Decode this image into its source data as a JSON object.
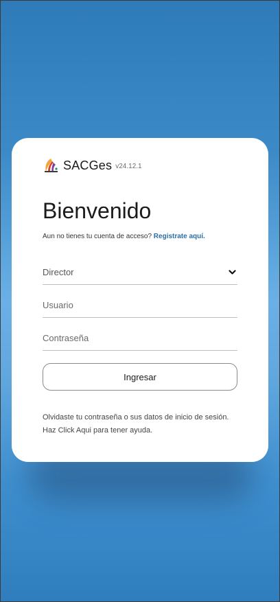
{
  "app": {
    "name": "SACGes",
    "version": "v24.12.1"
  },
  "login": {
    "title": "Bienvenido",
    "signup_prompt": "Aun no tienes tu cuenta de acceso?",
    "signup_link": "Registrate aquí.",
    "role_select": {
      "selected": "Director"
    },
    "username": {
      "placeholder": "Usuario"
    },
    "password": {
      "placeholder": "Contraseña"
    },
    "submit_label": "Ingresar",
    "help_line1": "Olvidaste tu contraseña o sus datos de inicio de sesión.",
    "help_line2": "Haz Click Aqui para tener ayuda."
  },
  "icons": {
    "logo": "sacges-logo-icon",
    "dropdown": "chevron-down-icon"
  },
  "colors": {
    "background_top": "#2f7bb9",
    "background_mid": "#6ab0e6",
    "card": "#ffffff",
    "link": "#2a6fa8"
  }
}
